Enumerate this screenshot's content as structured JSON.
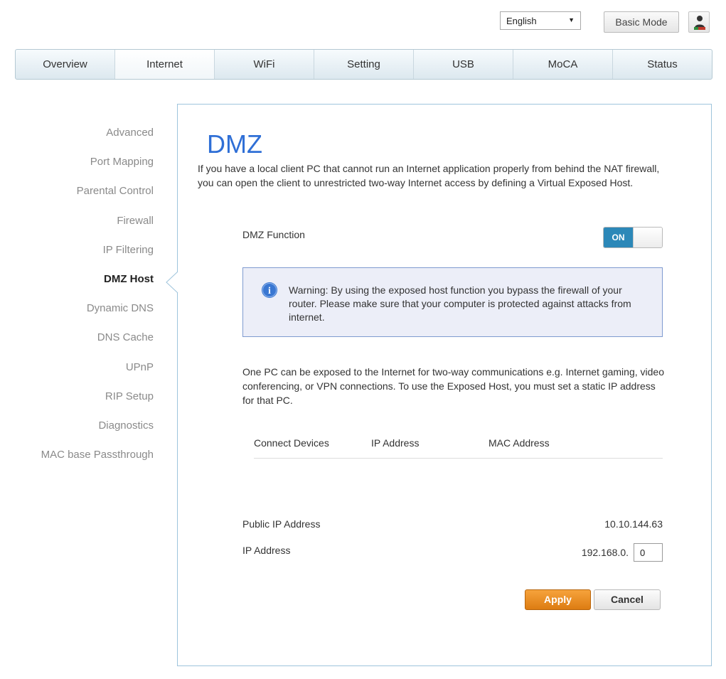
{
  "header": {
    "language": {
      "selected": "English"
    },
    "basic_mode_label": "Basic Mode",
    "user_icon": "user-admin-icon"
  },
  "nav": {
    "tabs": [
      {
        "label": "Overview"
      },
      {
        "label": "Internet",
        "active": true
      },
      {
        "label": "WiFi"
      },
      {
        "label": "Setting"
      },
      {
        "label": "USB"
      },
      {
        "label": "MoCA"
      },
      {
        "label": "Status"
      }
    ]
  },
  "sidebar": {
    "items": [
      {
        "label": "Advanced"
      },
      {
        "label": "Port Mapping"
      },
      {
        "label": "Parental Control"
      },
      {
        "label": "Firewall"
      },
      {
        "label": "IP Filtering"
      },
      {
        "label": "DMZ Host",
        "active": true
      },
      {
        "label": "Dynamic DNS"
      },
      {
        "label": "DNS Cache"
      },
      {
        "label": "UPnP"
      },
      {
        "label": "RIP Setup"
      },
      {
        "label": "Diagnostics"
      },
      {
        "label": "MAC base Passthrough"
      }
    ]
  },
  "main": {
    "title": "DMZ",
    "intro": "If you have a local client PC that cannot run an Internet application properly from behind the NAT firewall, you can open the client to unrestricted two-way Internet access by defining a Virtual Exposed Host.",
    "dmz_function": {
      "label": "DMZ Function",
      "state": "ON"
    },
    "warning": {
      "icon": "info-icon",
      "text": "Warning: By using the exposed host function you bypass the firewall of your router. Please make sure that your computer is protected against attacks from internet."
    },
    "description": "One PC can be exposed to the Internet for two-way communications e.g. Internet gaming, video conferencing, or VPN connections. To use the Exposed Host, you must set a static IP address for that PC.",
    "table": {
      "headers": [
        "Connect Devices",
        "IP Address",
        "MAC Address"
      ]
    },
    "public_ip": {
      "label": "Public IP Address",
      "value": "10.10.144.63"
    },
    "ip_address": {
      "label": "IP Address",
      "prefix": "192.168.0.",
      "value": "0"
    },
    "apply_label": "Apply",
    "cancel_label": "Cancel"
  },
  "colors": {
    "accent": "#2f6fd6",
    "toggle_on": "#2c88b8",
    "apply": "#e8891f",
    "warning_border": "#7f9bd0",
    "warning_bg": "#eceef8"
  }
}
